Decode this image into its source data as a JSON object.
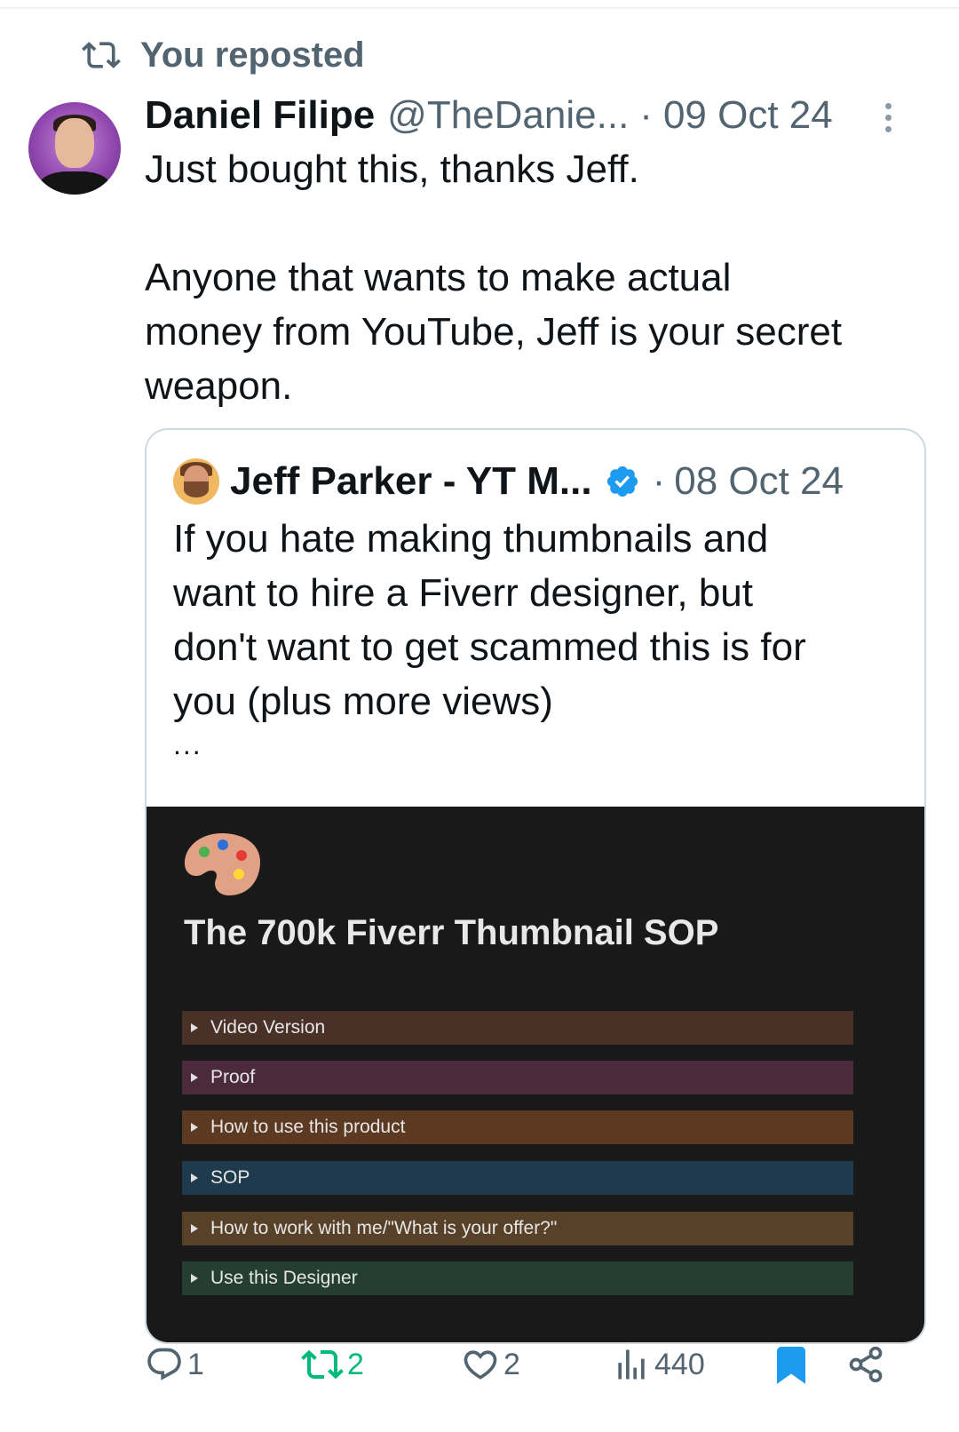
{
  "repost": {
    "label": "You reposted",
    "icon": "repost-icon"
  },
  "tweet": {
    "author_name": "Daniel Filipe",
    "handle": "@TheDanie...",
    "separator": "·",
    "date": "09 Oct 24",
    "text_lines": [
      "Just bought this, thanks Jeff.",
      "",
      "Anyone that wants to make actual",
      "money from YouTube, Jeff is your secret",
      "weapon."
    ]
  },
  "quote": {
    "author_name": "Jeff Parker - YT M...",
    "separator": "·",
    "date": "08 Oct 24",
    "text_lines": [
      "If you hate making thumbnails and",
      "want to hire a Fiverr designer, but",
      "don't want to get scammed this is for",
      "you (plus more views)"
    ],
    "ellipsis": "...",
    "media": {
      "title": "The 700k Fiverr Thumbnail SOP",
      "toggles": [
        {
          "label": "Video Version",
          "color": "#4a3128"
        },
        {
          "label": "Proof",
          "color": "#4b2a3e"
        },
        {
          "label": "How to use this product",
          "color": "#5c3a22"
        },
        {
          "label": "SOP",
          "color": "#1e3a4c"
        },
        {
          "label": "How to work with me/\"What is your offer?\"",
          "color": "#574128"
        },
        {
          "label": "Use this Designer",
          "color": "#243f32"
        }
      ]
    }
  },
  "actions": {
    "replies": "1",
    "reposts": "2",
    "likes": "2",
    "views": "440"
  },
  "colors": {
    "repost_active": "#00ba7c",
    "bookmark_active": "#1d9bf0",
    "muted": "#536471",
    "verified": "#1d9bf0"
  }
}
